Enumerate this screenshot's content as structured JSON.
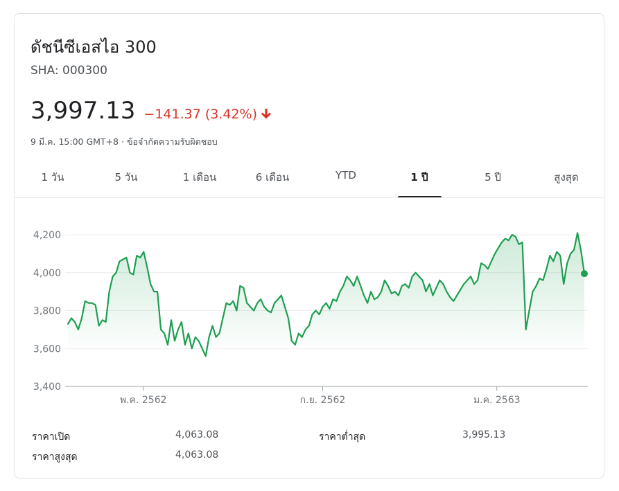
{
  "header": {
    "title": "ดัชนีซีเอสไอ 300",
    "ticker": "SHA: 000300",
    "price": "3,997.13",
    "change": "−141.37",
    "change_pct": "(3.42%)",
    "timestamp": "9 มี.ค. 15:00 GMT+8",
    "separator": "·",
    "disclaimer": "ข้อจำกัดความรับผิดชอบ"
  },
  "tabs": [
    {
      "label": "1 วัน",
      "active": false
    },
    {
      "label": "5 วัน",
      "active": false
    },
    {
      "label": "1 เดือน",
      "active": false
    },
    {
      "label": "6 เดือน",
      "active": false
    },
    {
      "label": "YTD",
      "active": false
    },
    {
      "label": "1 ปี",
      "active": true
    },
    {
      "label": "5 ปี",
      "active": false
    },
    {
      "label": "สูงสุด",
      "active": false
    }
  ],
  "stats": {
    "open_label": "ราคาเปิด",
    "open_value": "4,063.08",
    "low_label": "ราคาต่ำสุด",
    "low_value": "3,995.13",
    "high_label": "ราคาสูงสุด",
    "high_value": "4,063.08"
  },
  "colors": {
    "line": "#1e9e50",
    "down": "#d93025",
    "text": "#202124",
    "muted": "#70757a",
    "grid": "#ececec"
  },
  "chart_data": {
    "type": "area",
    "y_ticks": [
      "4,200",
      "4,000",
      "3,800",
      "3,600",
      "3,400"
    ],
    "y_tick_values": [
      4200,
      4000,
      3800,
      3600,
      3400
    ],
    "ylim": [
      3400,
      4200
    ],
    "x_tick_labels": [
      "พ.ค. 2562",
      "ก.ย. 2562",
      "ม.ค. 2563"
    ],
    "x_tick_positions": [
      0.145,
      0.49,
      0.825
    ],
    "grid": true,
    "series": [
      {
        "values": [
          3730,
          3760,
          3740,
          3700,
          3760,
          3850,
          3840,
          3840,
          3830,
          3720,
          3750,
          3740,
          3900,
          3980,
          4000,
          4060,
          4070,
          4080,
          4000,
          3990,
          4090,
          4080,
          4110,
          4030,
          3940,
          3900,
          3900,
          3700,
          3680,
          3620,
          3750,
          3640,
          3700,
          3740,
          3620,
          3680,
          3600,
          3660,
          3640,
          3600,
          3560,
          3660,
          3720,
          3660,
          3680,
          3760,
          3840,
          3830,
          3850,
          3800,
          3930,
          3920,
          3840,
          3820,
          3800,
          3840,
          3860,
          3820,
          3800,
          3790,
          3840,
          3860,
          3880,
          3820,
          3760,
          3640,
          3620,
          3680,
          3660,
          3700,
          3720,
          3780,
          3800,
          3780,
          3820,
          3840,
          3810,
          3860,
          3850,
          3900,
          3930,
          3980,
          3960,
          3930,
          3980,
          3930,
          3880,
          3840,
          3900,
          3860,
          3870,
          3900,
          3960,
          3930,
          3890,
          3900,
          3880,
          3930,
          3940,
          3920,
          3980,
          4000,
          3980,
          3960,
          3900,
          3940,
          3880,
          3920,
          3960,
          3940,
          3900,
          3870,
          3850,
          3880,
          3910,
          3940,
          3960,
          3980,
          3940,
          3960,
          4050,
          4040,
          4020,
          4060,
          4100,
          4130,
          4160,
          4180,
          4170,
          4200,
          4190,
          4150,
          4160,
          3700,
          3800,
          3900,
          3930,
          3970,
          3960,
          4020,
          4090,
          4060,
          4110,
          4090,
          3940,
          4050,
          4100,
          4120,
          4210,
          4120,
          3995
        ]
      }
    ]
  }
}
